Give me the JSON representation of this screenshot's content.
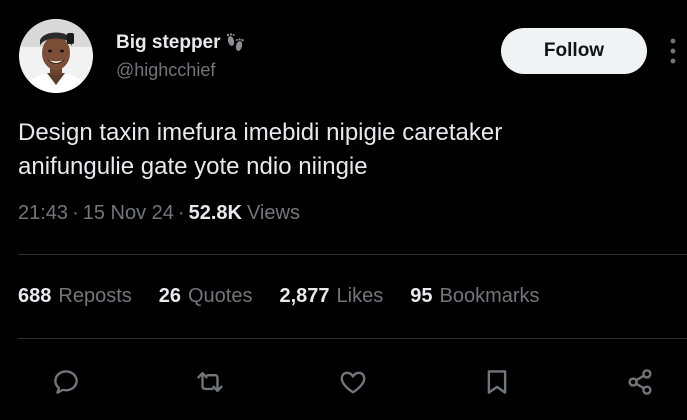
{
  "author": {
    "display_name": "Big stepper",
    "name_emoji": "footprints-icon",
    "handle": "@highcchief",
    "follow_label": "Follow"
  },
  "tweet": {
    "text": "Design taxin imefura imebidi nipigie caretaker\nanifungulie gate yote ndio niingie",
    "time": "21:43",
    "date": "15 Nov 24",
    "separator": "·",
    "views_count": "52.8K",
    "views_label": "Views"
  },
  "stats": [
    {
      "count": "688",
      "label": "Reposts"
    },
    {
      "count": "26",
      "label": "Quotes"
    },
    {
      "count": "2,877",
      "label": "Likes"
    },
    {
      "count": "95",
      "label": "Bookmarks"
    }
  ],
  "actions": [
    "reply-icon",
    "repost-icon",
    "like-icon",
    "bookmark-icon",
    "share-icon"
  ],
  "colors": {
    "background": "#000000",
    "primary_text": "#e7e9ea",
    "secondary_text": "#71767b",
    "divider": "#2f3336",
    "follow_bg": "#eff3f4",
    "follow_text": "#0f1419"
  }
}
